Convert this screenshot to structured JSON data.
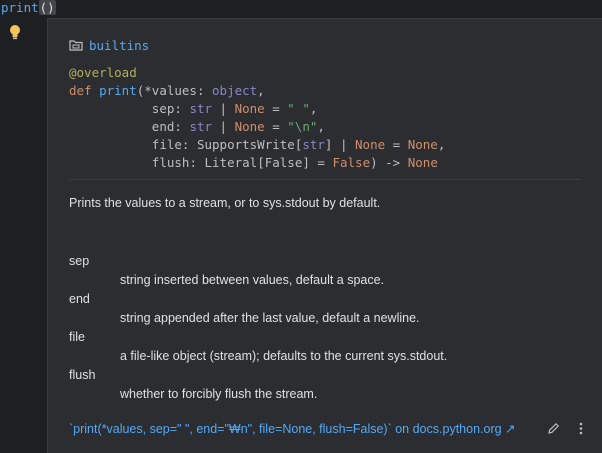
{
  "editor": {
    "fn_name": "print",
    "parens": "()"
  },
  "popup": {
    "module": "builtins",
    "signature": {
      "decorator": "@overload",
      "def_kw": "def",
      "fn": "print",
      "line1_rest": "(*values: ",
      "object_type": "object",
      "line2": {
        "name": "sep",
        "type": "str",
        "none": "None",
        "default": "\" \""
      },
      "line3": {
        "name": "end",
        "type": "str",
        "none": "None",
        "default": "\"\\n\""
      },
      "line4": {
        "name": "file",
        "type": "SupportsWrite",
        "type_arg": "str",
        "none": "None",
        "default": "None"
      },
      "line5": {
        "name": "flush",
        "type": "Literal",
        "type_arg": "False",
        "default": "False",
        "ret": "None"
      }
    },
    "description": "Prints the values to a stream, or to sys.stdout by default.",
    "params": [
      {
        "name": "sep",
        "desc": "string inserted between values, default a space."
      },
      {
        "name": "end",
        "desc": "string appended after the last value, default a newline."
      },
      {
        "name": "file",
        "desc": "a file-like object (stream); defaults to the current sys.stdout."
      },
      {
        "name": "flush",
        "desc": "whether to forcibly flush the stream."
      }
    ],
    "doc_link": "`print(*values, sep=\" \", end=\"₩n\", file=None, flush=False)` on docs.python.org",
    "doc_link_suffix": " ↗"
  }
}
